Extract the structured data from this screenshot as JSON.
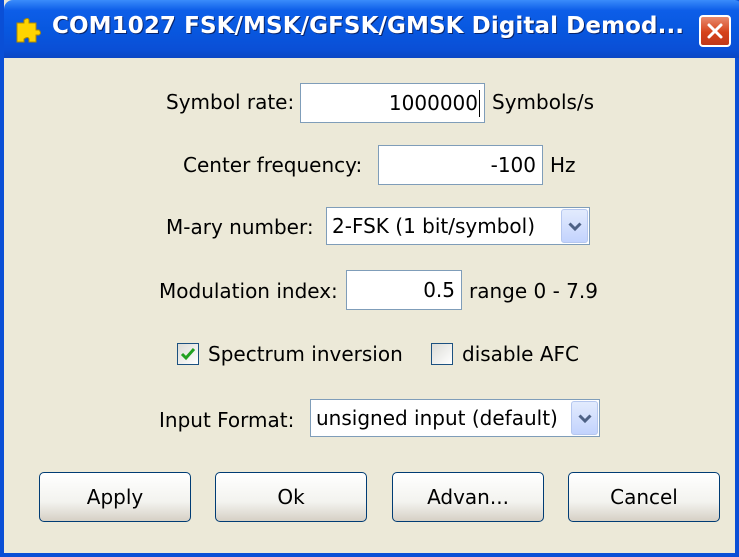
{
  "window": {
    "title": "COM1027 FSK/MSK/GFSK/GMSK Digital Demod...",
    "icon": "puzzle-piece-icon",
    "close_icon": "close-icon"
  },
  "form": {
    "symbol_rate": {
      "label": "Symbol rate:",
      "value": "1000000",
      "unit": "Symbols/s"
    },
    "center_frequency": {
      "label": "Center frequency:",
      "value": "-100",
      "unit": "Hz"
    },
    "mary_number": {
      "label": "M-ary number:",
      "selected": "2-FSK (1 bit/symbol)"
    },
    "modulation_index": {
      "label": "Modulation index:",
      "value": "0.5",
      "range": "range 0 - 7.9"
    },
    "spectrum_inversion": {
      "label": "Spectrum inversion",
      "checked": true
    },
    "disable_afc": {
      "label": "disable AFC",
      "checked": false
    },
    "input_format": {
      "label": "Input Format:",
      "selected": "unsigned input (default)"
    }
  },
  "buttons": {
    "apply": "Apply",
    "ok": "Ok",
    "advanced": "Advan...",
    "cancel": "Cancel"
  },
  "colors": {
    "titlebar": "#0a4fd6",
    "dialog_bg": "#ece9d8",
    "close_button": "#d6431a",
    "checkmark": "#21a121"
  }
}
